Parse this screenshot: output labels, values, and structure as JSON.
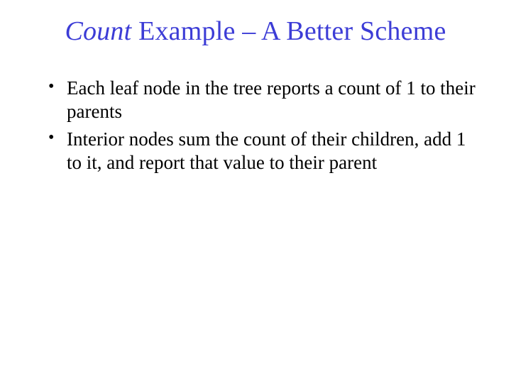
{
  "title": {
    "italic": "Count",
    "rest": " Example – A Better Scheme"
  },
  "bullets": [
    "Each leaf node in the tree reports a count of 1 to their parents",
    "Interior nodes sum the count of their children, add 1 to it, and report that value to their parent"
  ]
}
